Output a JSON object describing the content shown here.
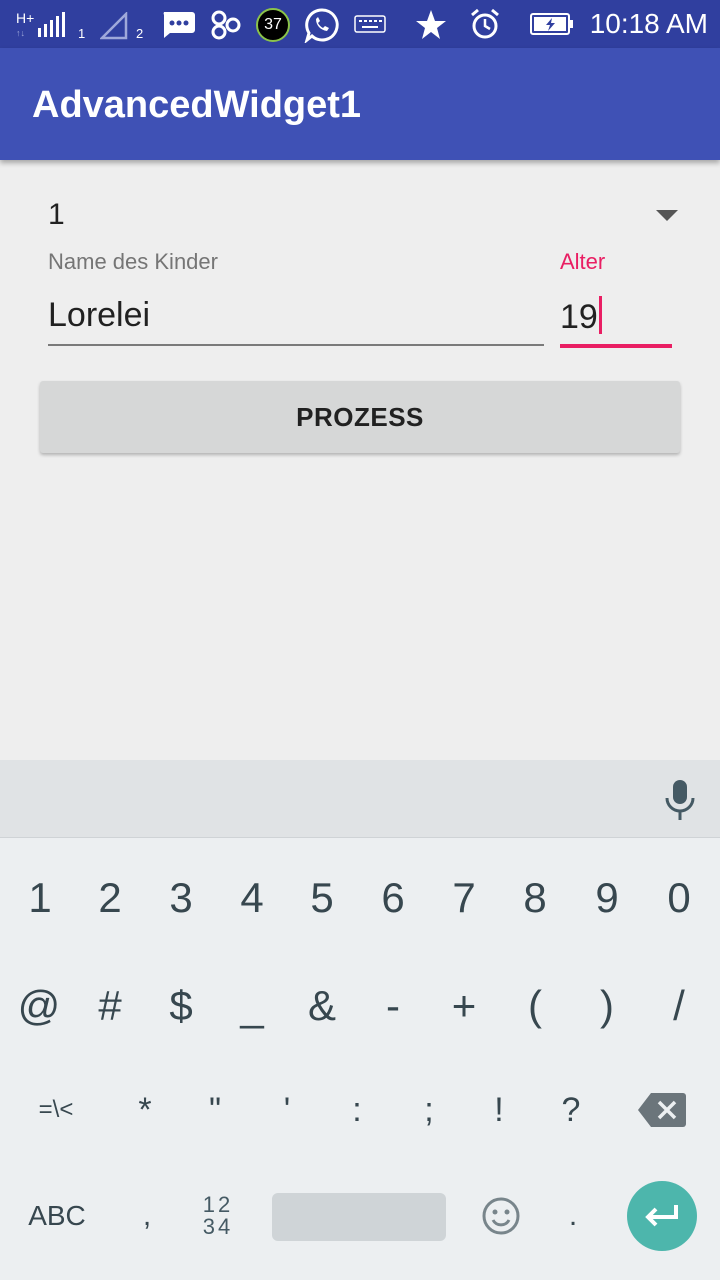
{
  "status_bar": {
    "network": "H+",
    "sim1_index": "1",
    "sim2_index": "2",
    "badge_count": "37",
    "time": "10:18 AM",
    "icons": [
      "signal-icon",
      "signal-empty-icon",
      "message-icon",
      "app-icon",
      "counter-badge-icon",
      "whatsapp-icon",
      "keyboard-icon",
      "star-icon",
      "alarm-icon",
      "battery-charging-icon"
    ]
  },
  "app_bar": {
    "title": "AdvancedWidget1"
  },
  "form": {
    "spinner_value": "1",
    "name_label": "Name des Kinder",
    "name_value": "Lorelei",
    "age_label": "Alter",
    "age_value": "19",
    "process_button": "PROZESS"
  },
  "keyboard": {
    "row1": [
      "1",
      "2",
      "3",
      "4",
      "5",
      "6",
      "7",
      "8",
      "9",
      "0"
    ],
    "row2": [
      "@",
      "#",
      "$",
      "_",
      "&",
      "-",
      "+",
      "(",
      ")",
      "/"
    ],
    "row3": [
      "=\\<",
      "*",
      "\"",
      "'",
      ":",
      ";",
      "!",
      "?"
    ],
    "abc_label": "ABC",
    "comma": ",",
    "numpad_top": "12",
    "numpad_bottom": "34",
    "period": "."
  },
  "colors": {
    "status_bar": "#303f9f",
    "app_bar": "#3f51b5",
    "accent": "#e91e63",
    "enter_key": "#4db6ac"
  }
}
